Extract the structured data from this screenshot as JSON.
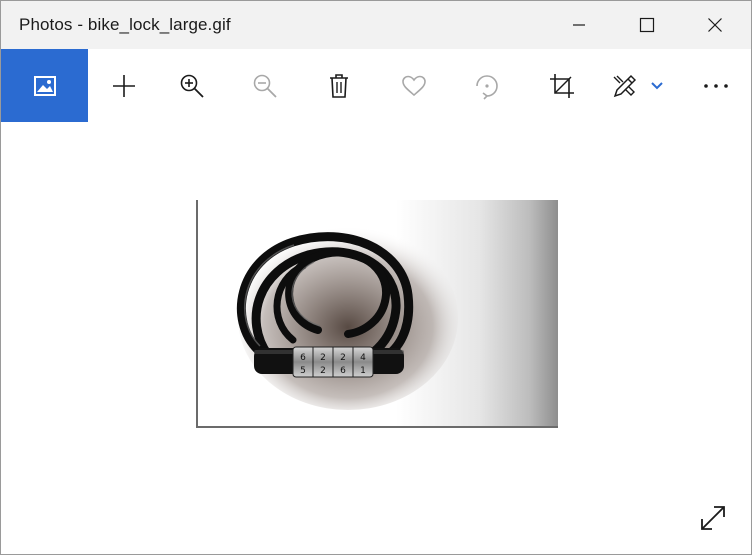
{
  "window": {
    "title": "Photos - bike_lock_large.gif",
    "controls": [
      {
        "name": "minimize-icon"
      },
      {
        "name": "maximize-icon"
      },
      {
        "name": "close-icon"
      }
    ]
  },
  "toolbar": {
    "accent_color": "#2b6bd1",
    "buttons": [
      {
        "name": "photo-icon",
        "state": "active"
      },
      {
        "name": "plus-icon",
        "state": "enabled"
      },
      {
        "name": "zoom-in-icon",
        "state": "enabled"
      },
      {
        "name": "zoom-out-icon",
        "state": "disabled"
      },
      {
        "name": "trash-icon",
        "state": "enabled"
      },
      {
        "name": "heart-icon",
        "state": "disabled"
      },
      {
        "name": "rotate-icon",
        "state": "disabled"
      },
      {
        "name": "crop-icon",
        "state": "enabled"
      },
      {
        "name": "edit-draw-icon",
        "state": "enabled"
      },
      {
        "name": "chevron-down-icon",
        "state": "enabled"
      },
      {
        "name": "more-icon",
        "state": "enabled"
      }
    ]
  },
  "image": {
    "subject": "bike-lock-image",
    "dial_digits_top": [
      "6",
      "2",
      "2",
      "4"
    ],
    "dial_digits_bottom": [
      "5",
      "2",
      "6",
      "1"
    ]
  },
  "content": {
    "expand_icon": "expand-icon"
  }
}
